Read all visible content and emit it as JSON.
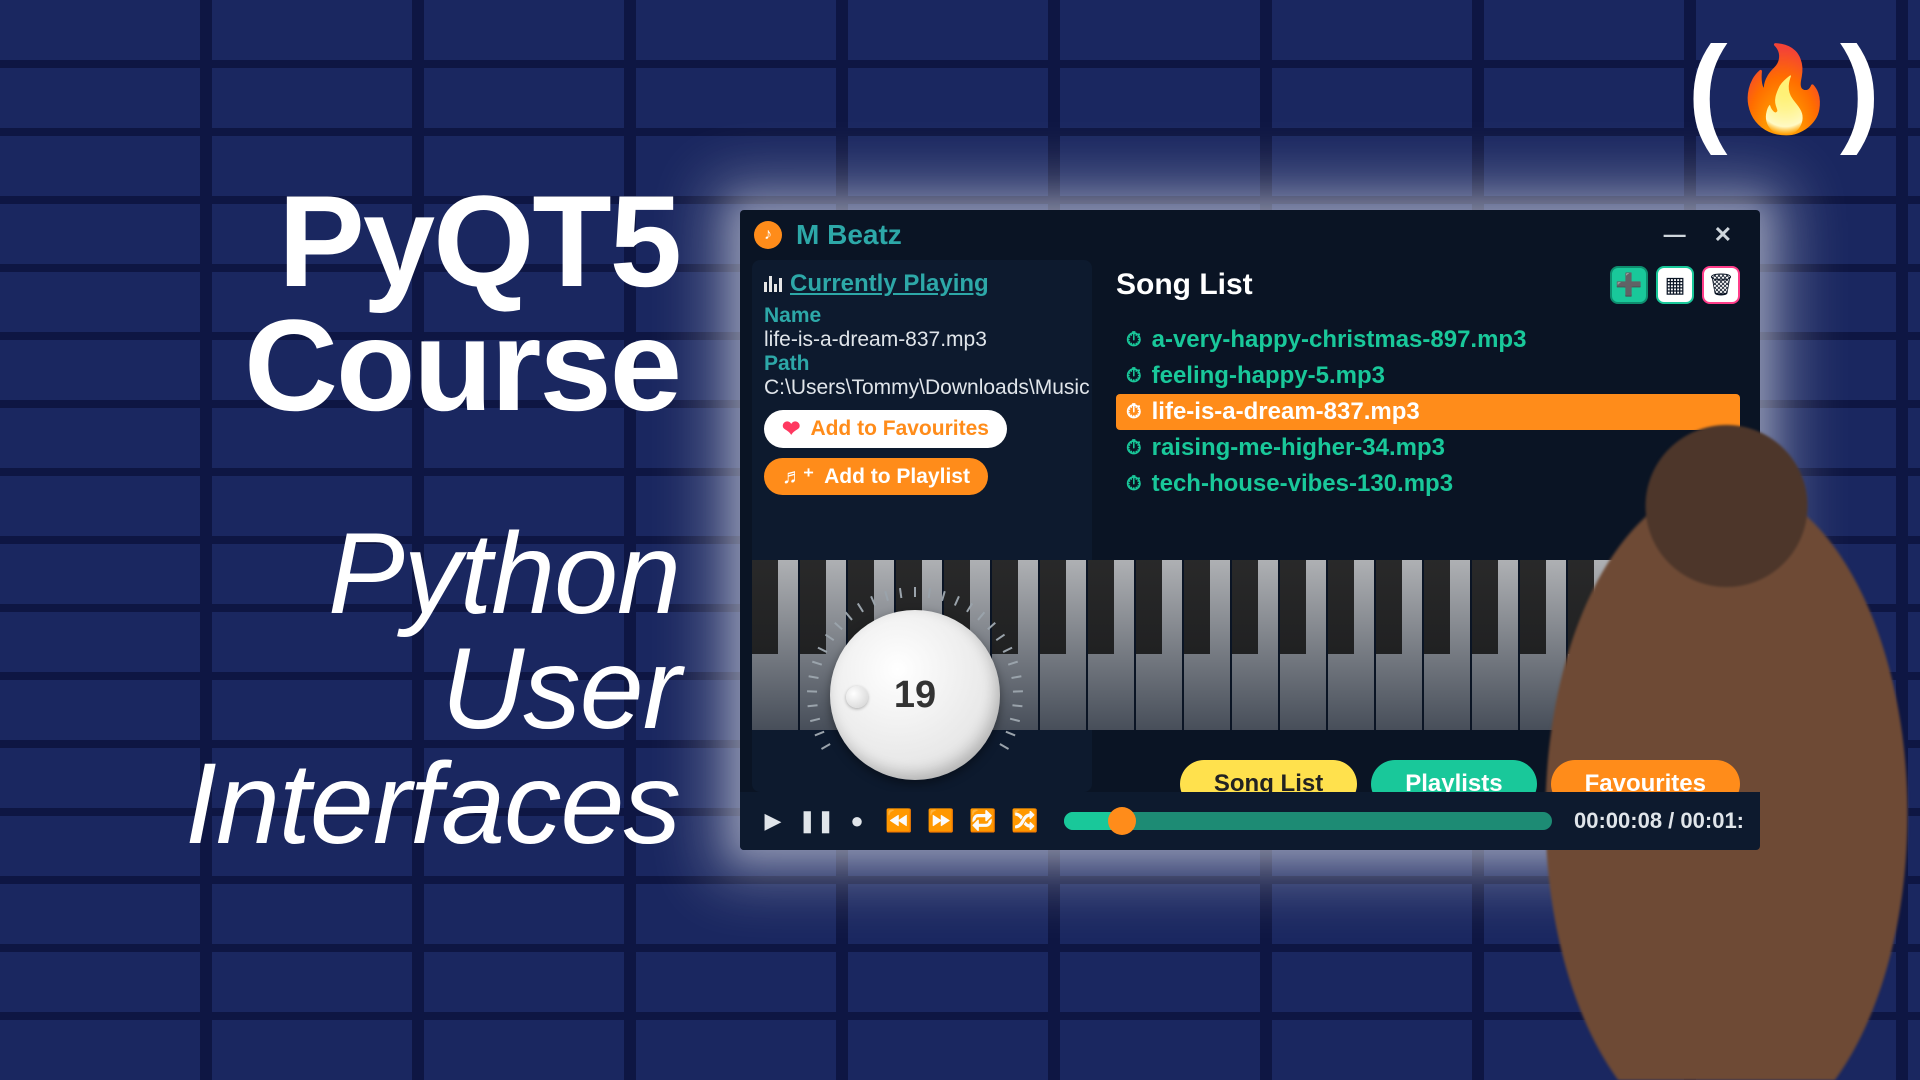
{
  "page": {
    "title_line_1": "PyQT5",
    "title_line_2": "Course",
    "subtitle_line_1": "Python",
    "subtitle_line_2": "User",
    "subtitle_line_3": "Interfaces"
  },
  "logo": {
    "left_paren": "(",
    "flame": "🔥",
    "right_paren": ")"
  },
  "app": {
    "title": "M Beatz",
    "window": {
      "minimize": "—",
      "close": "✕"
    },
    "currently_playing": {
      "heading": "Currently Playing",
      "name_label": "Name",
      "name_value": "life-is-a-dream-837.mp3",
      "path_label": "Path",
      "path_value": "C:\\Users\\Tommy\\Downloads\\Music"
    },
    "buttons": {
      "add_fav": "Add to Favourites",
      "add_playlist": "Add to Playlist"
    },
    "volume": {
      "value": "19"
    },
    "songlist": {
      "heading": "Song List",
      "items": [
        {
          "name": "a-very-happy-christmas-897.mp3",
          "selected": false
        },
        {
          "name": "feeling-happy-5.mp3",
          "selected": false
        },
        {
          "name": "life-is-a-dream-837.mp3",
          "selected": true
        },
        {
          "name": "raising-me-higher-34.mp3",
          "selected": false
        },
        {
          "name": "tech-house-vibes-130.mp3",
          "selected": false
        }
      ]
    },
    "tabs": {
      "song_list": "Song List",
      "playlists": "Playlists",
      "favourites": "Favourites"
    },
    "controls": {
      "play": "▶",
      "pause": "❚❚",
      "stop": "●",
      "prev": "⏪",
      "next": "⏩",
      "repeat": "🔁",
      "shuffle": "🔀"
    },
    "time": {
      "current": "00:00:08",
      "sep": " / ",
      "total": "00:01:"
    }
  }
}
